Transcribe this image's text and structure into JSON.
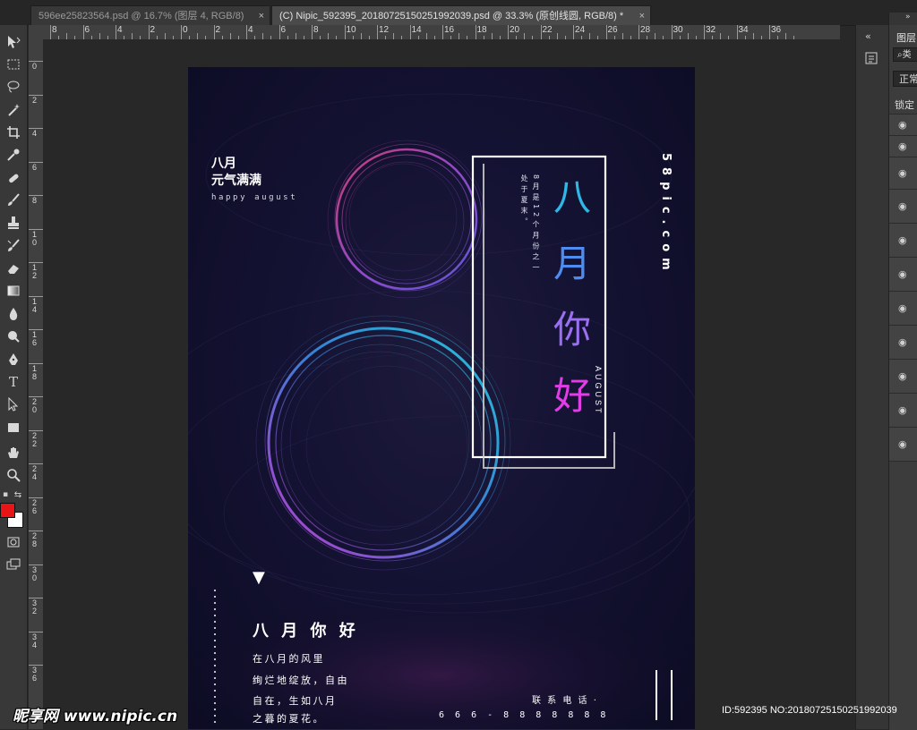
{
  "tabs": [
    {
      "label": "596ee25823564.psd @ 16.7% (图层 4, RGB/8)",
      "close": "×",
      "active": false
    },
    {
      "label": "(C) Nipic_592395_20180725150251992039.psd @ 33.3% (原创线圆, RGB/8) *",
      "close": "×",
      "active": true
    }
  ],
  "ruler_top": [
    "8",
    "6",
    "4",
    "2",
    "0",
    "2",
    "4",
    "6",
    "8",
    "10",
    "12",
    "14",
    "16",
    "18",
    "20",
    "22",
    "24",
    "26",
    "28",
    "30",
    "32",
    "34",
    "36"
  ],
  "ruler_left": [
    "0",
    "2",
    "4",
    "6",
    "8",
    "10",
    "12",
    "14",
    "16",
    "18",
    "20",
    "22",
    "24",
    "26",
    "28",
    "30",
    "32",
    "34",
    "36"
  ],
  "toolbar": {
    "icons": [
      "move-icon",
      "marquee-icon",
      "lasso-icon",
      "magic-wand-icon",
      "crop-icon",
      "eyedropper-icon",
      "healing-brush-icon",
      "brush-icon",
      "stamp-icon",
      "history-brush-icon",
      "eraser-icon",
      "gradient-icon",
      "blur-icon",
      "dodge-icon",
      "pen-icon",
      "type-icon",
      "path-select-icon",
      "rectangle-shape-icon",
      "hand-icon",
      "zoom-icon"
    ],
    "foreground_color": "#e81416",
    "background_color": "#ffffff"
  },
  "poster": {
    "top_left_title": "八月",
    "top_left_subtitle": "元气满满",
    "top_left_english": "happy august",
    "vertical_site": "58pic.com",
    "big_chars": [
      "八",
      "月",
      "你",
      "好"
    ],
    "big_char_colors": [
      "#2fb8e6",
      "#4f8cf0",
      "#9a6ff0",
      "#e23ce8"
    ],
    "vertical_small_col1": "8月是12个月份之一",
    "vertical_small_col2": "处于夏末。",
    "vertical_english": "AUGUST",
    "bottom_title": "八 月 你 好",
    "bottom_lines": [
      "在八月的风里",
      "绚烂地绽放，自由",
      "自在，生如八月",
      "之暮的夏花。"
    ],
    "contact_label": "联 系 电 话 ·",
    "phone": "6 6 6 - 8 8 8 8 8 8 8",
    "triangle": "▼"
  },
  "right_panel": {
    "layers_label": "图层",
    "blend_label": "正常",
    "lock_label": "锁定",
    "kind_label": "类"
  },
  "watermark": {
    "logo_text": "昵享网 www.nipic.cn",
    "id_text": "ID:592395 NO:20180725150251992039"
  }
}
